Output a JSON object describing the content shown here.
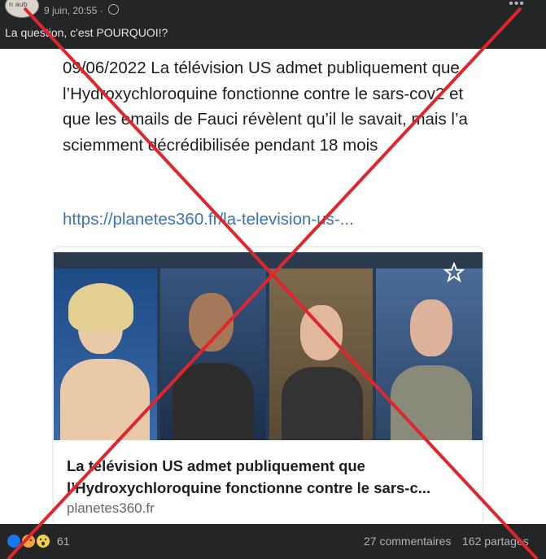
{
  "post": {
    "avatar_text": "n aub",
    "time": "9 juin, 20:55 ·",
    "caption": "La question, c'est POURQUOI!?",
    "more_icon": "•••"
  },
  "screenshot": {
    "text": "09/06/2022 La télévision US admet publiquement que l’Hydroxychloroquine fonctionne contre le sars-cov2 et que les emails de Fauci révèlent qu’il le savait, mais l’a sciemment décrédibilisée pendant 18 mois",
    "link": "https://planetes360.fr/la-television-us-...",
    "card": {
      "title": "La télévision US admet publiquement que l’Hydroxychloroquine fonctionne contre le sars-c...",
      "domain": "planetes360.fr"
    }
  },
  "footer": {
    "reaction_count": "61",
    "comments": "27 commentaires",
    "shares": "162 partages"
  },
  "colors": {
    "cross": "#e0262b",
    "link": "#3b73b9",
    "dark_bg": "#242526"
  }
}
